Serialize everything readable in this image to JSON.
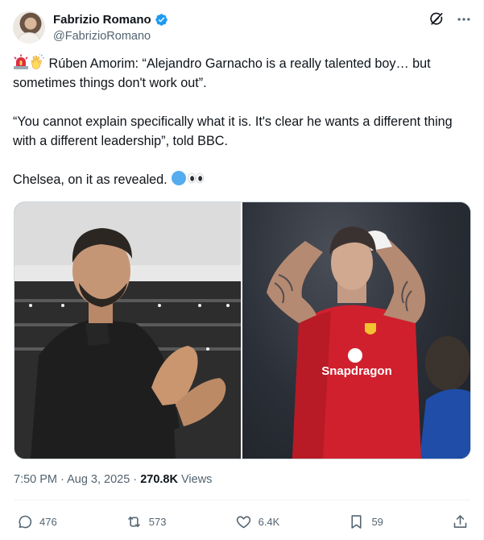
{
  "author": {
    "display_name": "Fabrizio Romano",
    "handle": "@FabrizioRomano",
    "verified_color": "#1d9bf0"
  },
  "header_icons": [
    "grok-icon",
    "more-icon"
  ],
  "tweet": {
    "para1": "Rúben Amorim: “Alejandro Garnacho is a really talented boy… but sometimes things don't work out”.",
    "para2": "“You cannot explain specifically what it is. It's clear he wants a different thing with a different leadership”, told BBC.",
    "para3": "Chelsea, on it as revealed."
  },
  "media": {
    "left_shirt_text": "",
    "right_shirt_text": "Snapdragon"
  },
  "meta": {
    "time": "7:50 PM",
    "sep1": " · ",
    "date": "Aug 3, 2025",
    "sep2": " · ",
    "views_count": "270.8K",
    "views_label": "Views"
  },
  "actions": {
    "replies": "476",
    "reposts": "573",
    "likes": "6.4K",
    "bookmarks": "59"
  },
  "colors": {
    "text_primary": "#0f1419",
    "text_secondary": "#536471",
    "united_red": "#d0202e"
  }
}
